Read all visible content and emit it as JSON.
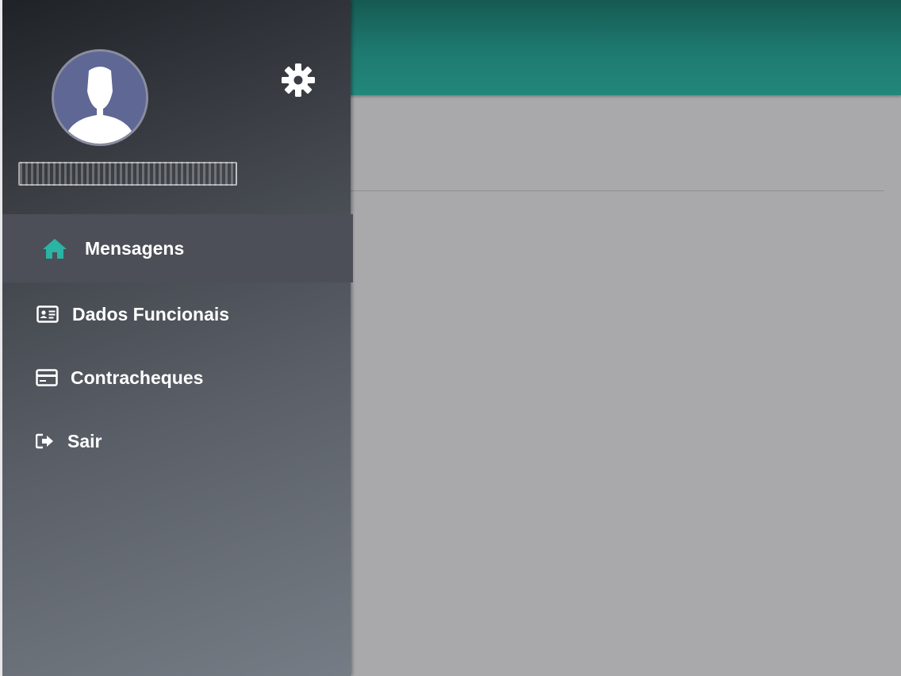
{
  "colors": {
    "accent": "#2bb3a3",
    "topbar": "#1e7a70",
    "overlay": "#a9a8ab",
    "menu_active": "#4c4f58"
  },
  "profile": {
    "name_obscured": "",
    "settings_icon": "gear-icon",
    "avatar_icon": "user-silhouette-icon"
  },
  "menu": {
    "items": [
      {
        "label": "Mensagens",
        "icon": "home-icon",
        "active": true
      },
      {
        "label": "Dados Funcionais",
        "icon": "id-card-icon",
        "active": false
      },
      {
        "label": "Contracheques",
        "icon": "credit-card-icon",
        "active": false
      },
      {
        "label": "Sair",
        "icon": "logout-icon",
        "active": false
      }
    ]
  }
}
